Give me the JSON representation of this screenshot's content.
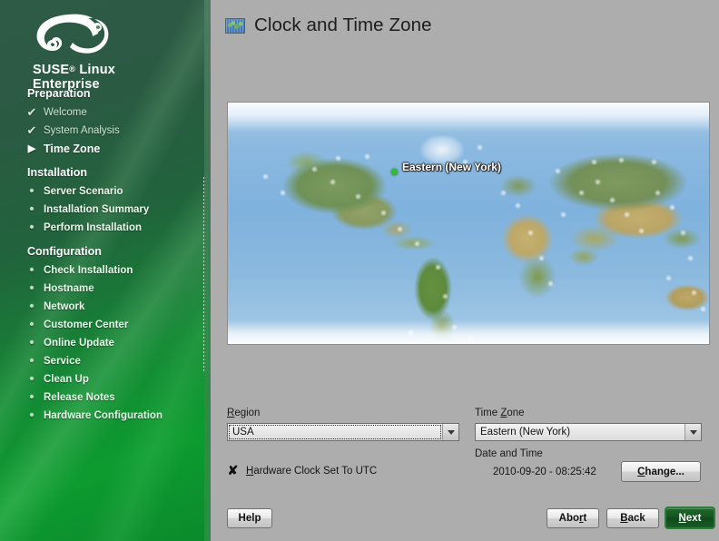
{
  "branding": {
    "logo_icon": "suse-chameleon-logo",
    "name_line1": "SUSE",
    "registered_mark": "®",
    "name_line1_suffix": " Linux",
    "name_line2": "Enterprise"
  },
  "sidebar": {
    "sections": [
      {
        "title": "Preparation",
        "items": [
          {
            "label": "Welcome",
            "state": "done",
            "marker": "✔"
          },
          {
            "label": "System Analysis",
            "state": "done",
            "marker": "✔"
          },
          {
            "label": "Time Zone",
            "state": "current",
            "marker": "▶"
          }
        ]
      },
      {
        "title": "Installation",
        "items": [
          {
            "label": "Server Scenario",
            "state": "pending",
            "marker": "•"
          },
          {
            "label": "Installation Summary",
            "state": "pending",
            "marker": "•"
          },
          {
            "label": "Perform Installation",
            "state": "pending",
            "marker": "•"
          }
        ]
      },
      {
        "title": "Configuration",
        "items": [
          {
            "label": "Check Installation",
            "state": "pending",
            "marker": "•"
          },
          {
            "label": "Hostname",
            "state": "pending",
            "marker": "•"
          },
          {
            "label": "Network",
            "state": "pending",
            "marker": "•"
          },
          {
            "label": "Customer Center",
            "state": "pending",
            "marker": "•"
          },
          {
            "label": "Online Update",
            "state": "pending",
            "marker": "•"
          },
          {
            "label": "Service",
            "state": "pending",
            "marker": "•"
          },
          {
            "label": "Clean Up",
            "state": "pending",
            "marker": "•"
          },
          {
            "label": "Release Notes",
            "state": "pending",
            "marker": "•"
          },
          {
            "label": "Hardware Configuration",
            "state": "pending",
            "marker": "•"
          }
        ]
      }
    ]
  },
  "header": {
    "icon": "world-map-icon",
    "title": "Clock and Time Zone"
  },
  "map": {
    "selected_label": "Eastern (New York)",
    "marker_color": "#2fbf2f"
  },
  "form": {
    "region_label": "Region",
    "region_label_mnemonic": "R",
    "region_value": "USA",
    "timezone_label": "Time Zone",
    "timezone_label_mnemonic": "Z",
    "timezone_value": "Eastern (New York)",
    "datetime_caption": "Date and Time",
    "datetime_value": "2010-09-20 - 08:25:42",
    "change_button": "Change...",
    "change_button_mnemonic": "C",
    "utc_checkbox_label": "Hardware Clock Set To UTC",
    "utc_checkbox_mnemonic": "H",
    "utc_checkbox_checked": true,
    "utc_checkbox_glyph": "✘"
  },
  "footer": {
    "help": "Help",
    "abort": "Abort",
    "abort_mnemonic": "r",
    "back": "Back",
    "back_mnemonic": "B",
    "next": "Next",
    "next_mnemonic": "N",
    "next_color": "#14521f"
  }
}
